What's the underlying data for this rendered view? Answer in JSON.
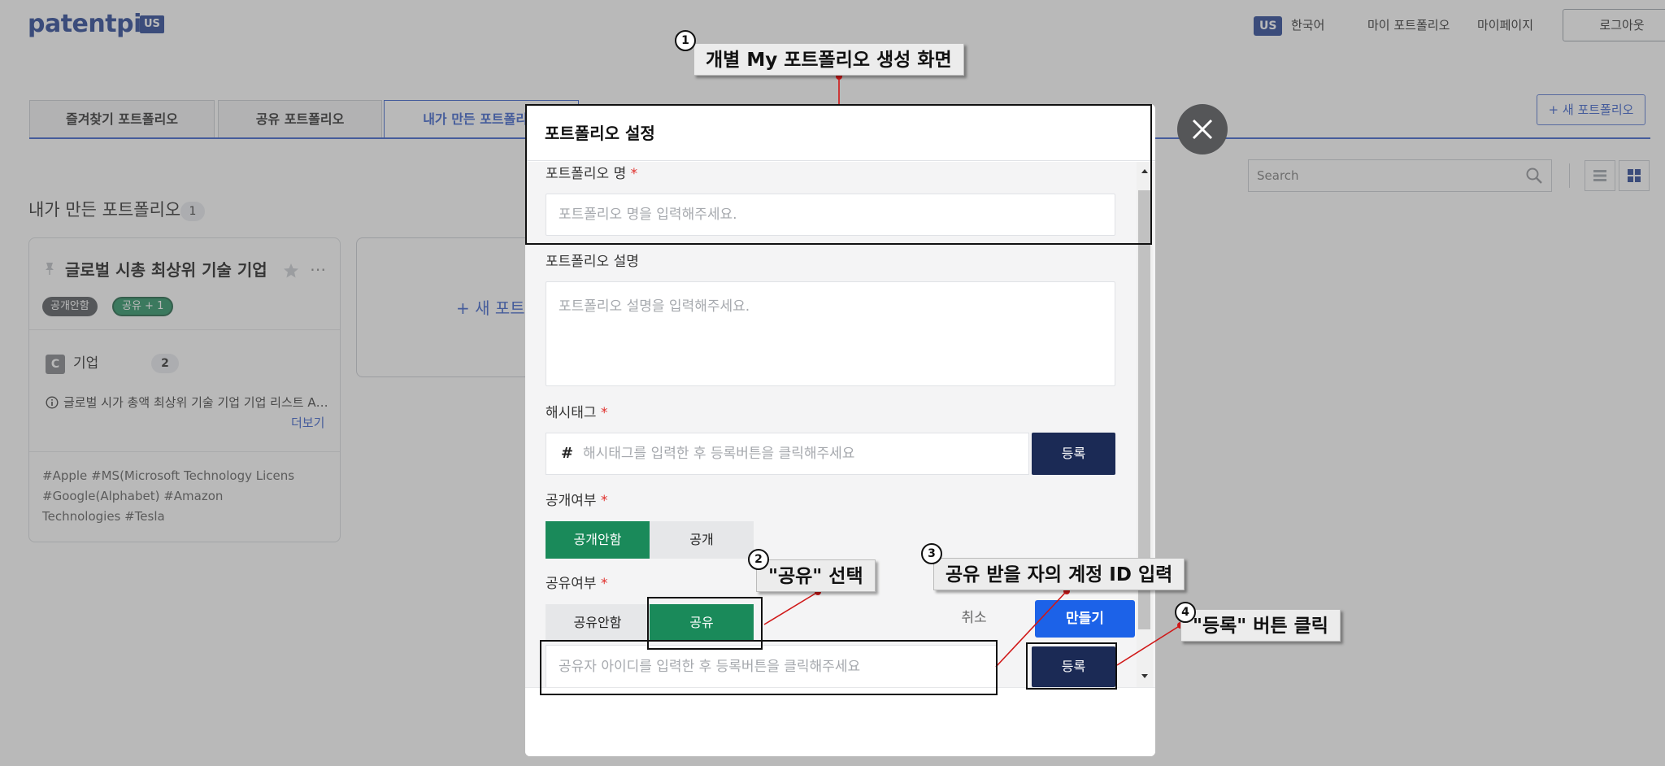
{
  "topbar": {
    "logo": "patentpia",
    "logo_badge": "US",
    "lang_badge": "US",
    "lang_label": "한국어",
    "nav_my_portfolio": "마이 포트폴리오",
    "nav_mypage": "마이페이지",
    "logout": "로그아웃"
  },
  "tabs": [
    {
      "label": "즐겨찾기 포트폴리오",
      "active": false
    },
    {
      "label": "공유 포트폴리오",
      "active": false
    },
    {
      "label": "내가 만든 포트폴리오",
      "active": true
    }
  ],
  "new_portfolio_button": "+ 새 포트폴리오",
  "search": {
    "placeholder": "Search"
  },
  "section": {
    "title": "내가 만든 포트폴리오",
    "count": "1"
  },
  "card": {
    "title": "글로벌 시총 최상위 기술 기업",
    "chip_public": "공개안함",
    "chip_share": "공유 + 1",
    "category_icon": "C",
    "category": "기업",
    "category_count": "2",
    "description": "글로벌 시가 총액 최상위 기술 기업 기업 리스트 A…",
    "more": "더보기",
    "tags": "#Apple #MS(Microsoft Technology Licens #Google(Alphabet) #Amazon Technologies #Tesla"
  },
  "new_card_label": "+ 새 포트",
  "modal": {
    "title": "포트폴리오 설정",
    "name_label": "포트폴리오 명",
    "name_placeholder": "포트폴리오 명을 입력해주세요.",
    "desc_label": "포트폴리오 설명",
    "desc_placeholder": "포트폴리오 설명을 입력해주세요.",
    "hashtag_label": "해시태그",
    "hashtag_symbol": "#",
    "hashtag_placeholder": "해시태그를 입력한 후 등록버튼을 클릭해주세요",
    "register": "등록",
    "public_label": "공개여부",
    "public_options": [
      "공개안함",
      "공개"
    ],
    "public_selected": "공개안함",
    "share_label": "공유여부",
    "share_options": [
      "공유안함",
      "공유"
    ],
    "share_selected": "공유",
    "share_placeholder": "공유자 아이디를 입력한 후 등록버튼을 클릭해주세요",
    "required_mark": "*",
    "cancel": "취소",
    "create": "만들기"
  },
  "annotations": [
    {
      "number": "1",
      "text": "개별 My 포트폴리오 생성 화면"
    },
    {
      "number": "2",
      "text": "\"공유\" 선택"
    },
    {
      "number": "3",
      "text": "공유 받을 자의 계정 ID 입력"
    },
    {
      "number": "4",
      "text": "\"등록\" 버튼 클릭"
    }
  ],
  "colors": {
    "brand": "#1a3a8f",
    "accent_blue": "#2c56c9",
    "toggle_green": "#1a8a5a",
    "navy_button": "#1b2a55",
    "create_button": "#1c62e8",
    "required": "#e0302c"
  }
}
